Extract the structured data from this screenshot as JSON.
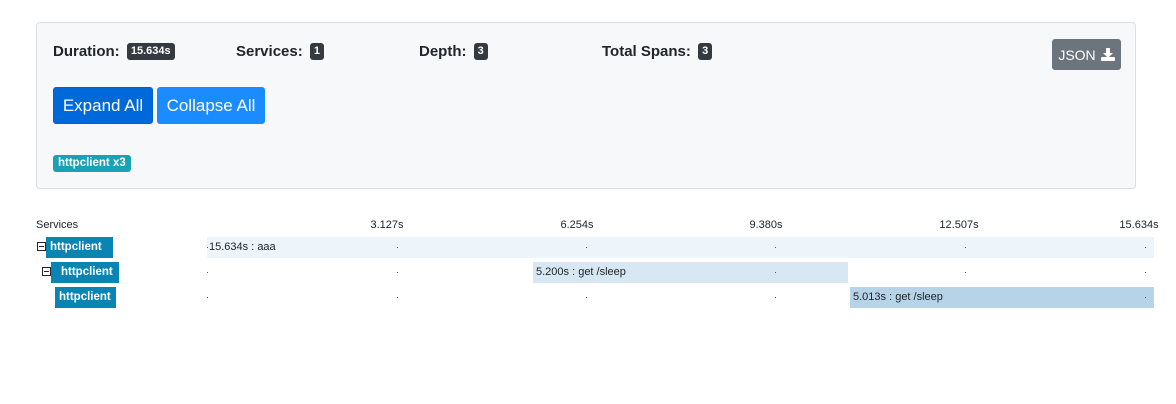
{
  "summary": {
    "duration_label": "Duration:",
    "duration_value": "15.634s",
    "services_label": "Services:",
    "services_value": "1",
    "depth_label": "Depth:",
    "depth_value": "3",
    "spans_label": "Total Spans:",
    "spans_value": "3",
    "json_label": "JSON"
  },
  "buttons": {
    "expand_all": "Expand All",
    "collapse_all": "Collapse All"
  },
  "service_badge": "httpclient x3",
  "timeline": {
    "services_header": "Services",
    "ticks": [
      "3.127s",
      "6.254s",
      "9.380s",
      "12.507s",
      "15.634s"
    ]
  },
  "spans": [
    {
      "service": "httpclient",
      "label": "15.634s : aaa",
      "depth": 0,
      "collapsible": true
    },
    {
      "service": "httpclient",
      "label": "5.200s : get /sleep",
      "depth": 1,
      "collapsible": true
    },
    {
      "service": "httpclient",
      "label": "5.013s : get /sleep",
      "depth": 2,
      "collapsible": false
    }
  ]
}
